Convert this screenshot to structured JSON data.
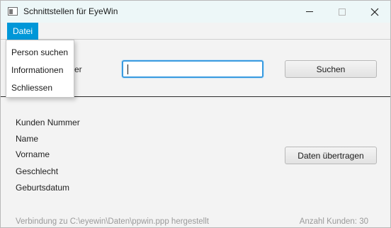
{
  "window": {
    "title": "Schnittstellen für EyeWin"
  },
  "menubar": {
    "datei": "Datei"
  },
  "dropdown": {
    "items": [
      "Person suchen",
      "Informationen",
      "Schliessen"
    ]
  },
  "search": {
    "label_partial": "er",
    "value": "",
    "button": "Suchen"
  },
  "fields": [
    "Kunden Nummer",
    "Name",
    "Vorname",
    "Geschlecht",
    "Geburtsdatum"
  ],
  "transfer": {
    "button": "Daten übertragen"
  },
  "status": {
    "connection": "Verbindung zu C:\\eyewin\\Daten\\ppwin.ppp hergestellt",
    "count": "Anzahl Kunden: 30"
  },
  "colors": {
    "accent": "#0097d8",
    "focus": "#3a9be0"
  }
}
